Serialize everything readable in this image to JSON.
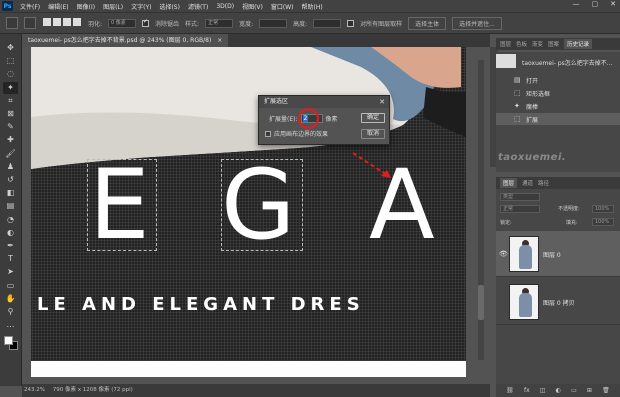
{
  "app": {
    "logo": "Ps"
  },
  "menu": [
    "文件(F)",
    "编辑(E)",
    "图像(I)",
    "图层(L)",
    "文字(Y)",
    "选择(S)",
    "滤镜(T)",
    "3D(D)",
    "视图(V)",
    "窗口(W)",
    "帮助(H)"
  ],
  "window_controls": {
    "minimize": "—",
    "maximize": "▢",
    "close": "✕"
  },
  "options": {
    "feather_label": "羽化:",
    "feather_value": "0 像素",
    "antialias_label": "消除锯齿",
    "style_label": "样式:",
    "style_value": "正常",
    "width_label": "宽度:",
    "height_label": "高度:",
    "sample_all_label": "对所有图层取样",
    "subject_button": "选择主体",
    "select_mask_button": "选择并遮住..."
  },
  "tools": [
    {
      "name": "move-tool-icon",
      "glyph": "✥"
    },
    {
      "name": "marquee-tool-icon",
      "glyph": "⬚"
    },
    {
      "name": "lasso-tool-icon",
      "glyph": "◌"
    },
    {
      "name": "magic-wand-tool-icon",
      "glyph": "✦"
    },
    {
      "name": "crop-tool-icon",
      "glyph": "⌗"
    },
    {
      "name": "frame-tool-icon",
      "glyph": "⊠"
    },
    {
      "name": "eyedropper-tool-icon",
      "glyph": "✎"
    },
    {
      "name": "healing-tool-icon",
      "glyph": "✚"
    },
    {
      "name": "brush-tool-icon",
      "glyph": "🖌"
    },
    {
      "name": "stamp-tool-icon",
      "glyph": "♟"
    },
    {
      "name": "history-brush-icon",
      "glyph": "↺"
    },
    {
      "name": "eraser-tool-icon",
      "glyph": "◧"
    },
    {
      "name": "gradient-tool-icon",
      "glyph": "▤"
    },
    {
      "name": "blur-tool-icon",
      "glyph": "◔"
    },
    {
      "name": "dodge-tool-icon",
      "glyph": "◐"
    },
    {
      "name": "pen-tool-icon",
      "glyph": "✒"
    },
    {
      "name": "type-tool-icon",
      "glyph": "T"
    },
    {
      "name": "path-select-icon",
      "glyph": "➤"
    },
    {
      "name": "shape-tool-icon",
      "glyph": "▭"
    },
    {
      "name": "hand-tool-icon",
      "glyph": "✋"
    },
    {
      "name": "zoom-tool-icon",
      "glyph": "⚲"
    },
    {
      "name": "more-tools-icon",
      "glyph": "…"
    }
  ],
  "document": {
    "tab_title": "taoxuemei- ps怎么把字去掉不背景.psd @ 243% (图层 0, RGB/8)",
    "tab_close": "×",
    "letters": [
      "E",
      "G",
      "A"
    ],
    "tagline": "LE AND ELEGANT DRES"
  },
  "status": {
    "zoom": "243.2%",
    "dims": "790 像素 x 1208 像素 (72 ppi)"
  },
  "dialog": {
    "title": "扩展选区",
    "close": "✕",
    "expand_label": "扩展量(E):",
    "expand_value": "2",
    "unit": "像素",
    "apply_edge_label": "应用画布边界的效果",
    "ok": "确定",
    "cancel": "取消"
  },
  "right_panels": {
    "top_tabs": [
      "图层",
      "色板",
      "渐变",
      "图案",
      "历史记录"
    ],
    "history_items": [
      {
        "label": "taoxuemei- ps怎么把字去掉不..."
      },
      {
        "label": "打开",
        "glyph": "▤"
      },
      {
        "label": "矩形选框",
        "glyph": "⬚"
      },
      {
        "label": "魔棒",
        "glyph": "✦"
      },
      {
        "label": "扩展",
        "glyph": "⬚"
      }
    ],
    "watermark": "taoxuemei.",
    "layer_tabs": [
      "图层",
      "通道",
      "路径"
    ],
    "kind_label": "类型",
    "blend_mode": "正常",
    "opacity_label": "不透明度:",
    "opacity_value": "100%",
    "lock_label": "锁定:",
    "fill_label": "填充:",
    "fill_value": "100%",
    "layers": [
      {
        "name": "图层 0",
        "visible": true,
        "selected": true
      },
      {
        "name": "图层 0 拷贝",
        "visible": false,
        "selected": false
      }
    ],
    "footer_icons": [
      "⛓",
      "fx",
      "◫",
      "◐",
      "▭",
      "⊞",
      "🗑"
    ]
  }
}
